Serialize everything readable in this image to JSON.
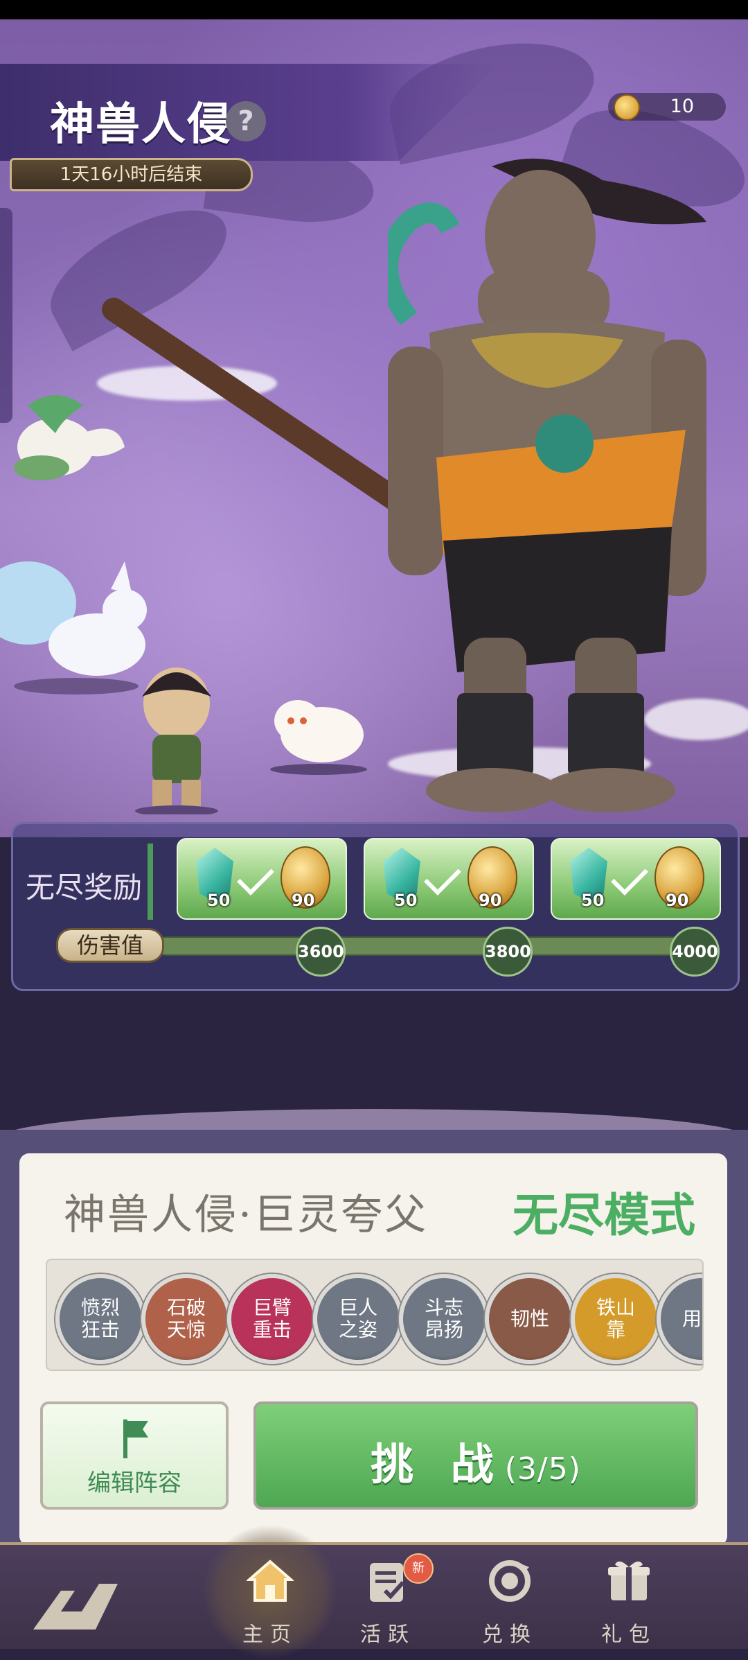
{
  "event": {
    "title": "神兽人侵",
    "timer": "1天16小时后结束",
    "help_icon": "question-icon"
  },
  "currency": {
    "icon": "gold-ingot-icon",
    "value": "10"
  },
  "rewards": {
    "label": "无尽奖励",
    "cards": [
      {
        "gem_qty": "50",
        "coin_qty": "90",
        "claimed": true
      },
      {
        "gem_qty": "50",
        "coin_qty": "90",
        "claimed": true
      },
      {
        "gem_qty": "50",
        "coin_qty": "90",
        "claimed": true
      }
    ],
    "damage_label": "伤害值",
    "milestones": [
      "3600",
      "3800",
      "4000"
    ],
    "progress_fraction": 0.0
  },
  "boss": {
    "name": "神兽人侵·巨灵夸父",
    "mode": "无尽模式",
    "skills": [
      {
        "label": "愤烈狂击",
        "color": "#6f7784"
      },
      {
        "label": "石破天惊",
        "color": "#b0614a"
      },
      {
        "label": "巨臂重击",
        "color": "#b8325a"
      },
      {
        "label": "巨人之姿",
        "color": "#6f7784"
      },
      {
        "label": "斗志昂扬",
        "color": "#6f7784"
      },
      {
        "label": "韧性",
        "color": "#8a5a48"
      },
      {
        "label": "铁山靠",
        "color": "#d49a2a"
      },
      {
        "label": "用过",
        "color": "#6f7784"
      }
    ]
  },
  "actions": {
    "edit_label": "编辑阵容",
    "challenge_label": "挑 战",
    "challenge_count": "(3/5)"
  },
  "nav": {
    "items": [
      {
        "label": "主页",
        "icon": "home-icon",
        "active": true
      },
      {
        "label": "活跃",
        "icon": "task-board-icon",
        "badge": true
      },
      {
        "label": "兑换",
        "icon": "exchange-icon"
      },
      {
        "label": "礼包",
        "icon": "gift-box-icon"
      }
    ]
  },
  "colors": {
    "accent_green": "#4cae62",
    "panel_purple": "#565078",
    "nav_bg": "#3d3149"
  }
}
